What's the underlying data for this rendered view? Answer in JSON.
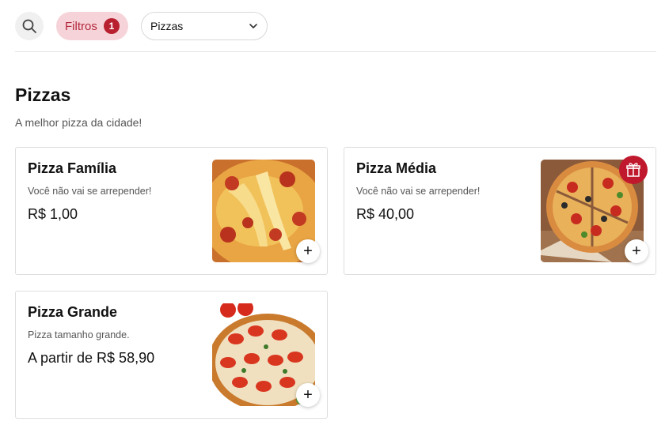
{
  "toolbar": {
    "search_icon": "search-icon",
    "filter_label": "Filtros",
    "filter_count": "1",
    "category_select_value": "Pizzas",
    "chevron_icon": "chevron-down-icon"
  },
  "section": {
    "title": "Pizzas",
    "subtitle": "A melhor pizza da cidade!"
  },
  "products": [
    {
      "name": "Pizza Família",
      "description": "Você não vai se arrepender!",
      "price": "R$ 1,00"
    },
    {
      "name": "Pizza Média",
      "description": "Você não vai se arrepender!",
      "price": "R$ 40,00",
      "badge_icon": "gift-icon"
    },
    {
      "name": "Pizza Grande",
      "description": "Pizza tamanho grande.",
      "price": "A partir de R$ 58,90"
    }
  ],
  "add_label": "+",
  "colors": {
    "accent": "#b8202f",
    "filter_bg": "#f6d3d8",
    "filter_text": "#b3263b"
  }
}
